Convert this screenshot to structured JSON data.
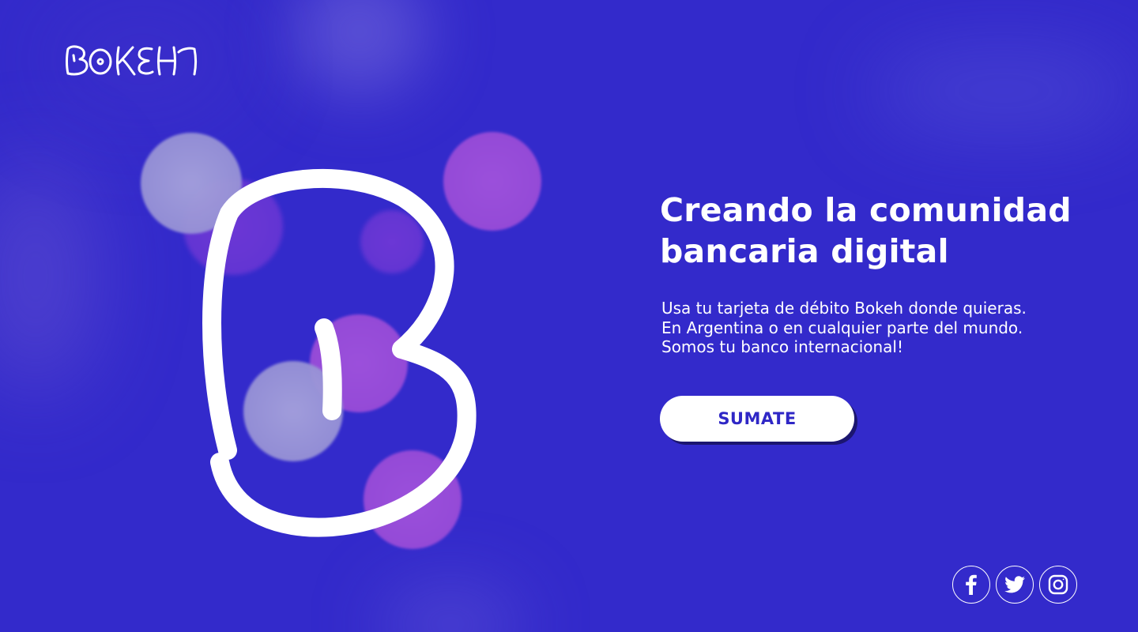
{
  "brand": {
    "name": "BOKEH",
    "primary_color": "#332acb",
    "accent_color": "#ffffff",
    "button_text_color": "#2f27c6"
  },
  "hero": {
    "headline_line1": "Creando la comunidad",
    "headline_line2": "bancaria digital",
    "description_line1": "Usa tu tarjeta de débito Bokeh donde quieras.",
    "description_line2": "En Argentina o en cualquier parte del mundo.",
    "description_line3": "Somos tu banco internacional!",
    "cta_label": "SUMATE"
  },
  "social": {
    "items": [
      {
        "icon": "facebook-icon"
      },
      {
        "icon": "twitter-icon"
      },
      {
        "icon": "instagram-icon"
      }
    ]
  }
}
